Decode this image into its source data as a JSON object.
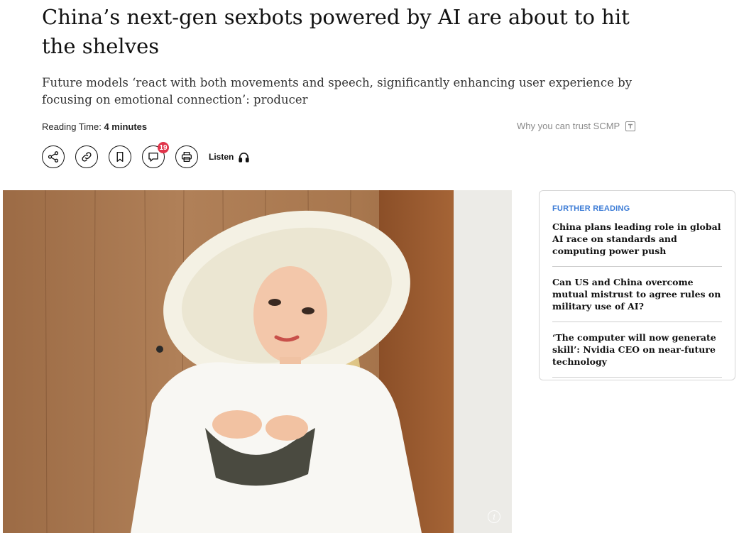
{
  "article": {
    "headline": "China’s next-gen sexbots powered by AI are about to hit the shelves",
    "subhead": "Future models ‘react with both movements and speech, significantly enhancing user experience by focusing on emotional connection’: producer",
    "reading_time_label": "Reading Time: ",
    "reading_time_value": "4 minutes",
    "trust_link": "Why you can trust SCMP"
  },
  "actions": {
    "share_icon": "share-icon",
    "link_icon": "link-icon",
    "bookmark_icon": "bookmark-icon",
    "comment_icon": "comment-icon",
    "comment_count": "19",
    "print_icon": "print-icon",
    "listen_label": "Listen",
    "listen_icon": "headphones-icon"
  },
  "further_reading": {
    "title": "FURTHER READING",
    "items": [
      "China plans leading role in global AI race on standards and computing power push",
      "Can US and China overcome mutual mistrust to agree rules on military use of AI?",
      "‘The computer will now generate skill’: Nvidia CEO on near-future technology"
    ]
  },
  "colors": {
    "accent_blue": "#3b7bd6",
    "badge_red": "#e0344a",
    "muted_text": "#8a8a8a"
  }
}
